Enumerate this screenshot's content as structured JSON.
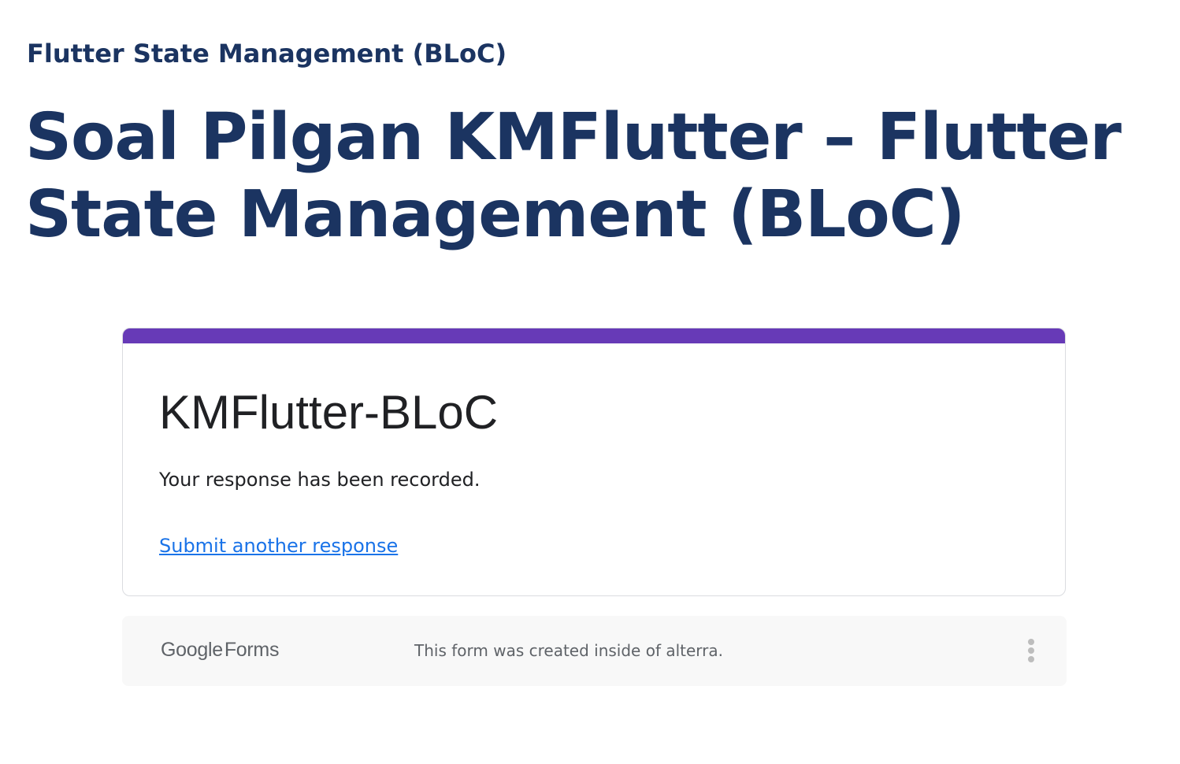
{
  "breadcrumb": {
    "text": "Flutter State Management (BLoC)"
  },
  "page": {
    "title": "Soal Pilgan KMFlutter – Flutter State Management (BLoC)"
  },
  "form": {
    "accent_color": "#673ab7",
    "title": "KMFlutter-BLoC",
    "message": "Your response has been recorded.",
    "link_label": "Submit another response",
    "link_color": "#1a73e8"
  },
  "footer": {
    "logo_google": "Google",
    "logo_forms": "Forms",
    "note": "This form was created inside of alterra.",
    "menu_icon": "more-vert-icon"
  },
  "colors": {
    "heading": "#1b3461",
    "text": "#202124",
    "muted": "#5f6368",
    "footer_bg": "#f8f8f8"
  }
}
